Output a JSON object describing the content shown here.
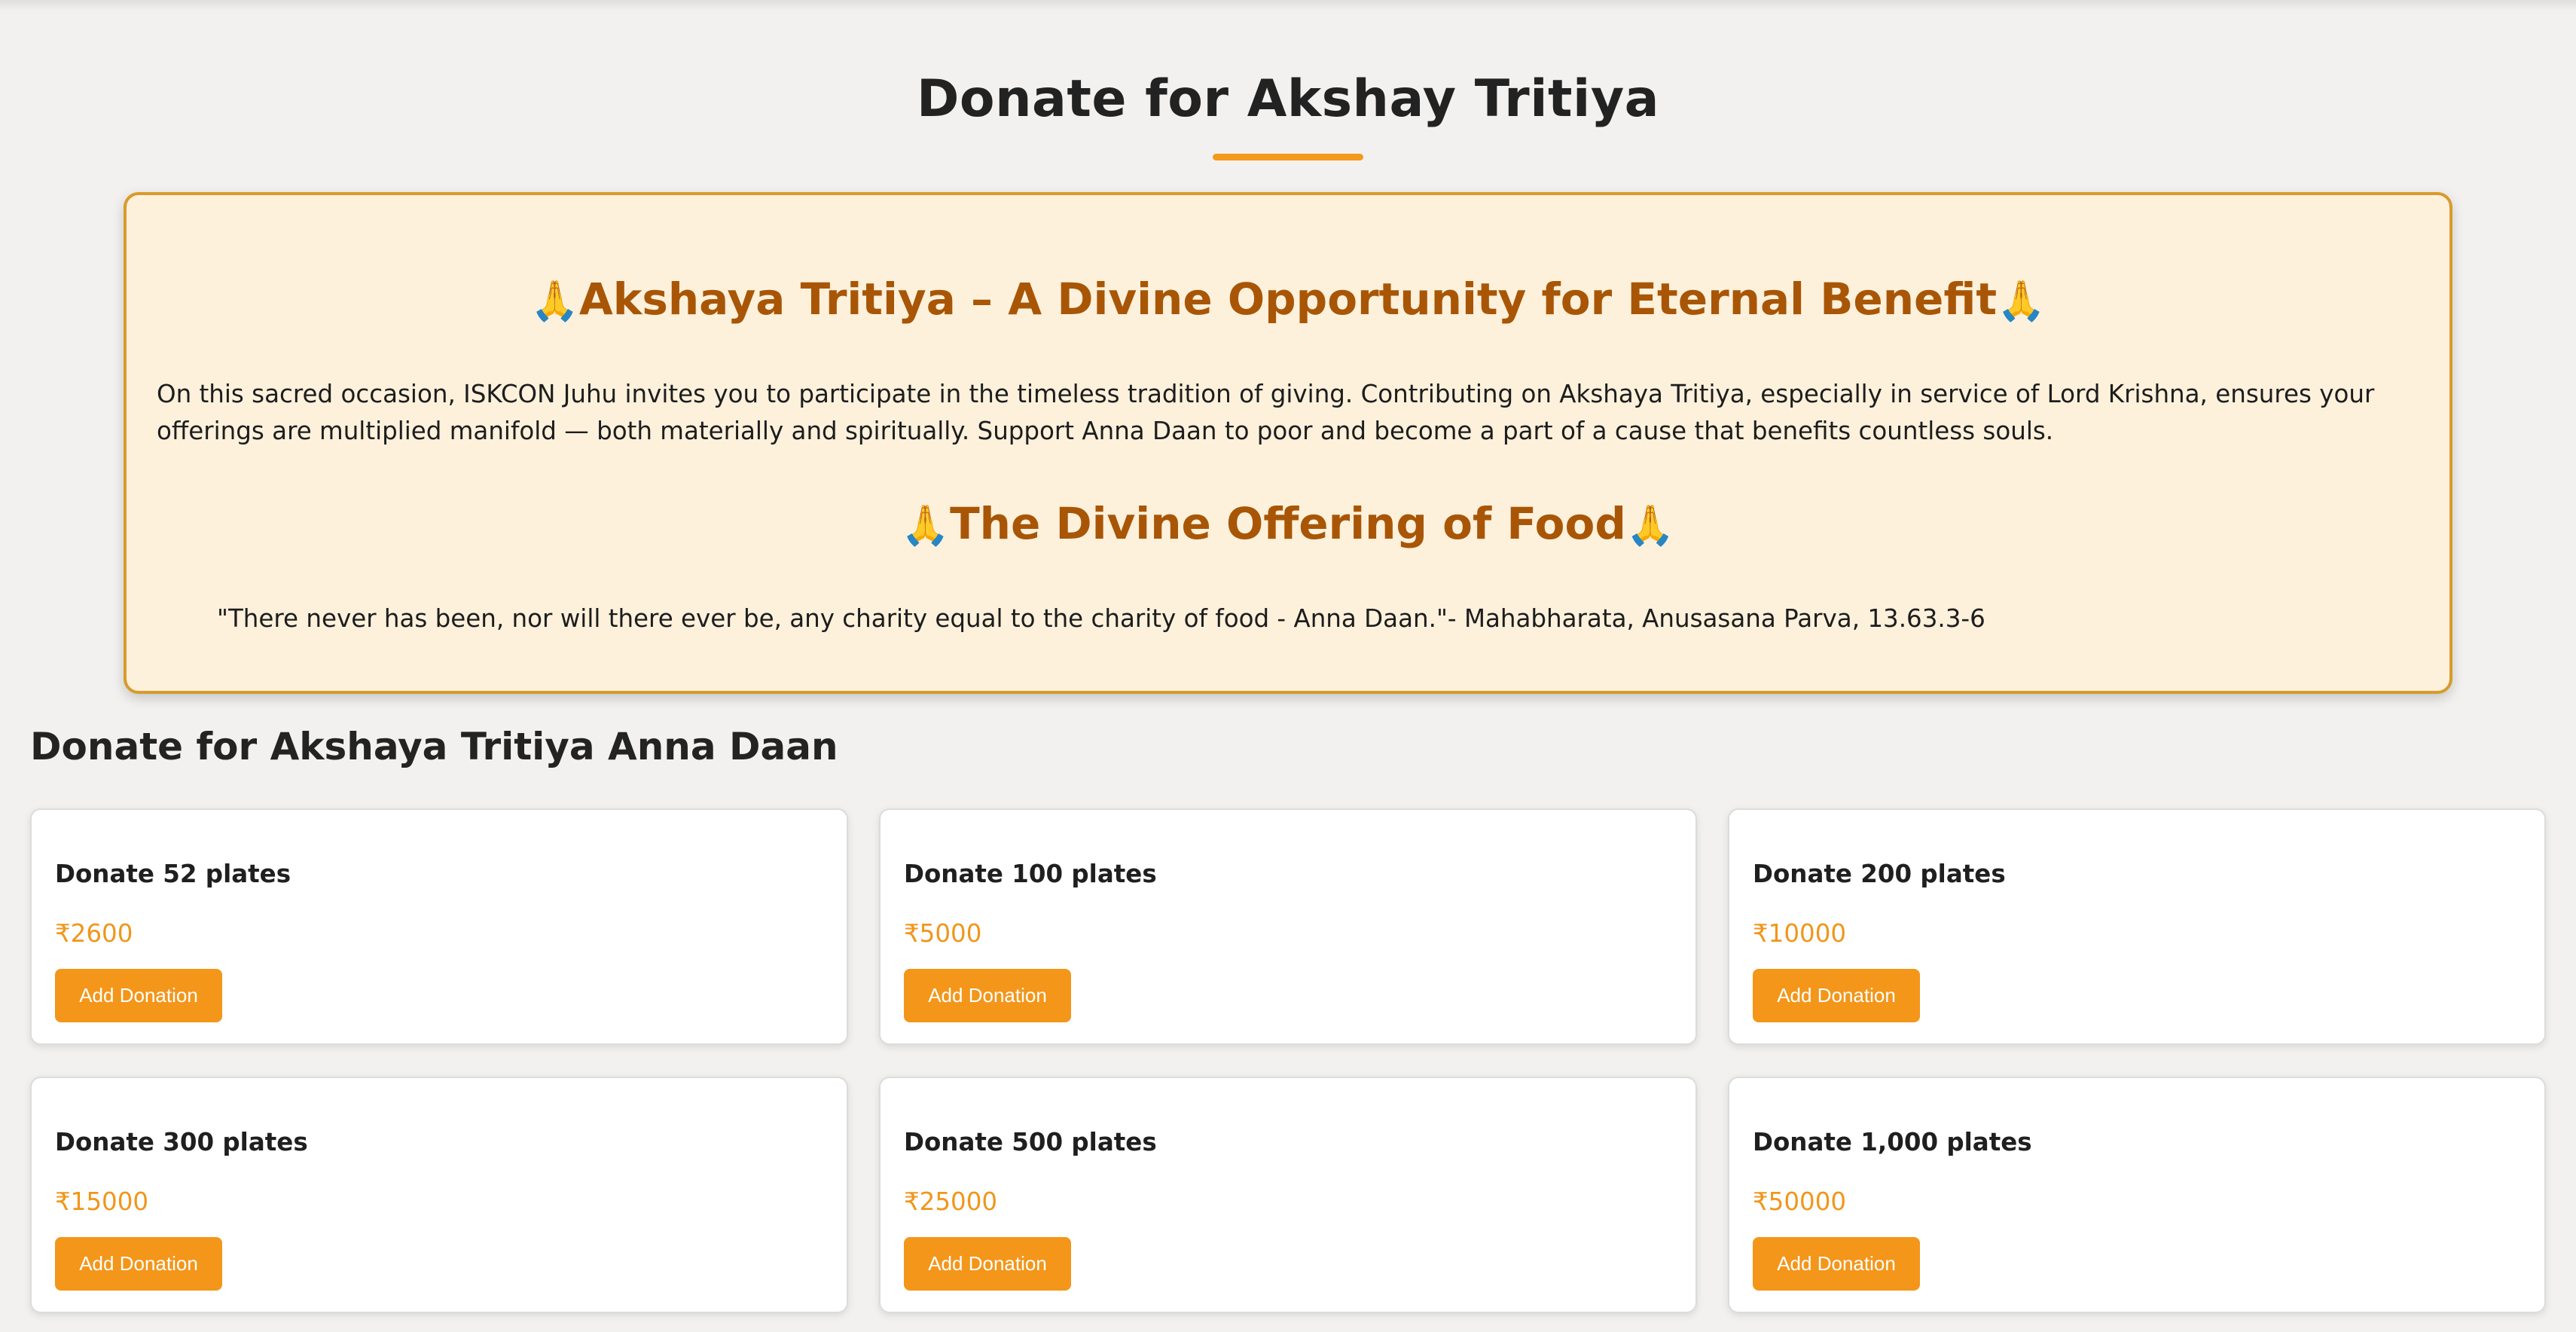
{
  "page": {
    "title": "Donate for Akshay Tritiya"
  },
  "info": {
    "icon": "🙏",
    "heading1": "Akshaya Tritiya – A Divine Opportunity for Eternal Benefit",
    "paragraph": "On this sacred occasion, ISKCON Juhu invites you to participate in the timeless tradition of giving. Contributing on Akshaya Tritiya, especially in service of Lord Krishna, ensures your offerings are multiplied manifold — both materially and spiritually. Support Anna Daan to poor and become a part of a cause that benefits countless souls.",
    "heading2": "The Divine Offering of Food",
    "quote": "\"There never has been, nor will there ever be, any charity equal to the charity of food - Anna Daan.\"- Mahabharata, Anusasana Parva, 13.63.3-6"
  },
  "section": {
    "title": "Donate for Akshaya Tritiya Anna Daan"
  },
  "cards": [
    {
      "title": "Donate 52 plates",
      "price": "₹2600",
      "button": "Add Donation"
    },
    {
      "title": "Donate 100 plates",
      "price": "₹5000",
      "button": "Add Donation"
    },
    {
      "title": "Donate 200 plates",
      "price": "₹10000",
      "button": "Add Donation"
    },
    {
      "title": "Donate 300 plates",
      "price": "₹15000",
      "button": "Add Donation"
    },
    {
      "title": "Donate 500 plates",
      "price": "₹25000",
      "button": "Add Donation"
    },
    {
      "title": "Donate 1,000 plates",
      "price": "₹50000",
      "button": "Add Donation"
    }
  ],
  "colors": {
    "accent": "#f3961a",
    "heading_brown": "#a85606",
    "info_bg": "#fdf1dc",
    "info_border": "#d99a2b"
  }
}
